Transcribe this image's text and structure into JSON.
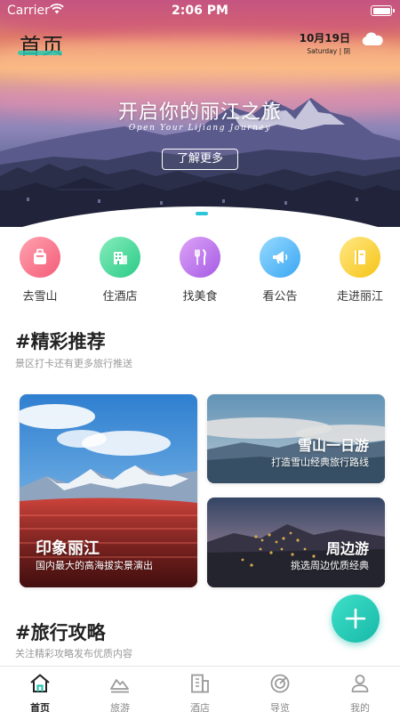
{
  "status_bar": {
    "carrier": "Carrier",
    "time": "2:06 PM"
  },
  "header": {
    "title": "首页",
    "date": "10月19日",
    "date_sub": "Saturday | 阴",
    "weather_icon": "cloud-icon"
  },
  "hero": {
    "title": "开启你的丽江之旅",
    "subtitle": "Open Your Lijiang Journey",
    "button_label": "了解更多",
    "accent": "#2bc6d8"
  },
  "categories": [
    {
      "label": "去雪山",
      "icon": "luggage-icon",
      "color_from": "#ff9aa8",
      "color_to": "#f4607a"
    },
    {
      "label": "住酒店",
      "icon": "hotel-icon",
      "color_from": "#7ee8b6",
      "color_to": "#2fcf8c"
    },
    {
      "label": "找美食",
      "icon": "fork-knife-icon",
      "color_from": "#d99cf5",
      "color_to": "#a85ee6"
    },
    {
      "label": "看公告",
      "icon": "megaphone-icon",
      "color_from": "#8fd6ff",
      "color_to": "#3aa8f5"
    },
    {
      "label": "走进丽江",
      "icon": "book-icon",
      "color_from": "#ffe680",
      "color_to": "#f8c81c"
    }
  ],
  "recommend": {
    "title": "#精彩推荐",
    "subtitle": "景区打卡还有更多旅行推送",
    "cards": [
      {
        "title": "印象丽江",
        "subtitle": "国内最大的高海拔实景演出"
      },
      {
        "title": "雪山一日游",
        "subtitle": "打造雪山经典旅行路线"
      },
      {
        "title": "周边游",
        "subtitle": "挑选周边优质经典"
      }
    ]
  },
  "guide": {
    "title": "#旅行攻略",
    "subtitle": "关注精彩攻略发布优质内容"
  },
  "fab": {
    "icon": "plus-icon",
    "color": "#1fc1ae"
  },
  "tabbar": {
    "items": [
      {
        "label": "首页",
        "icon": "home-icon",
        "active": true
      },
      {
        "label": "旅游",
        "icon": "mountain-icon",
        "active": false
      },
      {
        "label": "酒店",
        "icon": "building-icon",
        "active": false
      },
      {
        "label": "导览",
        "icon": "target-icon",
        "active": false
      },
      {
        "label": "我的",
        "icon": "user-icon",
        "active": false
      }
    ]
  }
}
